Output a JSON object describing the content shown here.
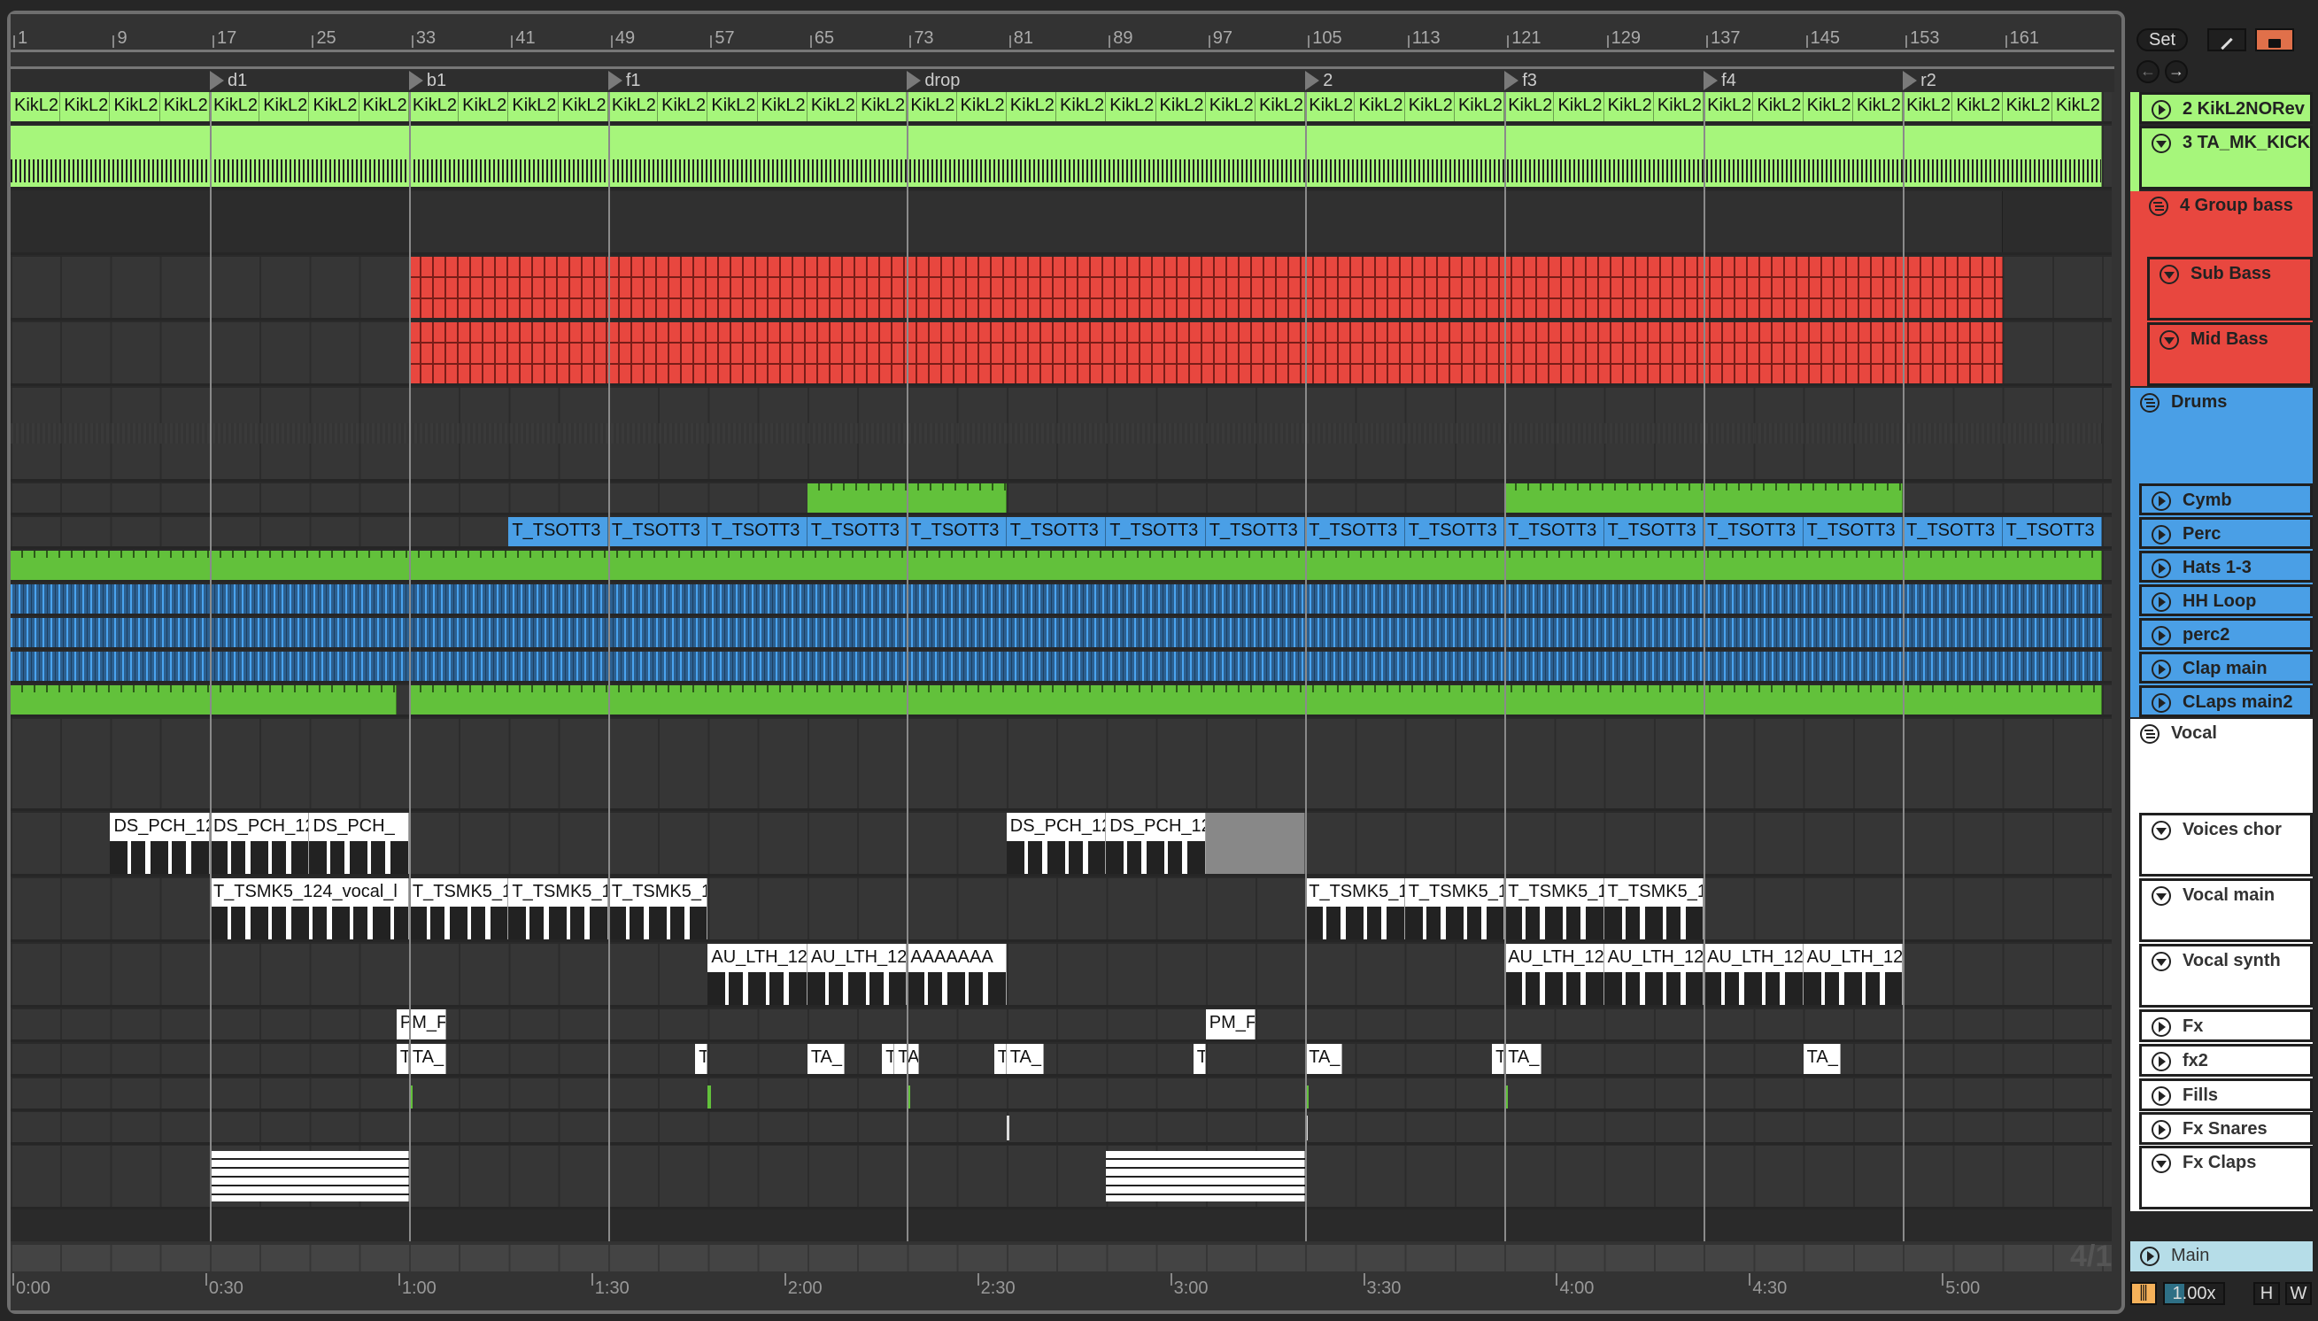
{
  "ruler": {
    "bars": [
      "1",
      "9",
      "17",
      "25",
      "33",
      "41",
      "49",
      "57",
      "65",
      "73",
      "81",
      "89",
      "97",
      "105",
      "113",
      "121",
      "129",
      "137",
      "145",
      "153",
      "161"
    ]
  },
  "locators": [
    {
      "name": "d1",
      "bar": 17
    },
    {
      "name": "b1",
      "bar": 33
    },
    {
      "name": "f1",
      "bar": 49
    },
    {
      "name": "drop",
      "bar": 73
    },
    {
      "name": "2",
      "bar": 105
    },
    {
      "name": "f3",
      "bar": 121
    },
    {
      "name": "f4",
      "bar": 137
    },
    {
      "name": "r2",
      "bar": 153
    }
  ],
  "time_ruler": [
    "0:00",
    "0:30",
    "1:00",
    "1:30",
    "2:00",
    "2:30",
    "3:00",
    "3:30",
    "4:00",
    "4:30",
    "5:00"
  ],
  "tempo_bpm_implied": 124,
  "colors": {
    "kick": "#a6f67b",
    "bass": "#e8473f",
    "drums": "#4a9fe6",
    "green": "#62c13b",
    "vocal": "#ffffff",
    "main": "#b6dde8",
    "lock": "#e0704a",
    "follow": "#f5b15a"
  },
  "tracks": [
    {
      "name": "2 KikL2NORev",
      "icon": "play",
      "color": "#a6f67b"
    },
    {
      "name": "3 TA_MK_KICK",
      "icon": "fold-down",
      "color": "#a6f67b"
    },
    {
      "name": "4 Group bass",
      "icon": "group",
      "color": "#e8473f"
    },
    {
      "name": "Sub Bass",
      "icon": "fold-down",
      "color": "#e8473f"
    },
    {
      "name": "Mid Bass",
      "icon": "fold-down",
      "color": "#e8473f"
    },
    {
      "name": "Drums",
      "icon": "group",
      "color": "#4a9fe6"
    },
    {
      "name": "Cymb",
      "icon": "play",
      "color": "#4a9fe6"
    },
    {
      "name": "Perc",
      "icon": "play",
      "color": "#4a9fe6"
    },
    {
      "name": "Hats 1-3",
      "icon": "play",
      "color": "#4a9fe6"
    },
    {
      "name": "HH Loop",
      "icon": "play",
      "color": "#4a9fe6"
    },
    {
      "name": "perc2",
      "icon": "play",
      "color": "#4a9fe6"
    },
    {
      "name": "Clap main",
      "icon": "play",
      "color": "#4a9fe6"
    },
    {
      "name": "CLaps main2",
      "icon": "play",
      "color": "#4a9fe6"
    },
    {
      "name": "Vocal",
      "icon": "group",
      "color": "#ffffff"
    },
    {
      "name": "Voices chor",
      "icon": "fold-down",
      "color": "#ffffff"
    },
    {
      "name": "Vocal main",
      "icon": "fold-down",
      "color": "#ffffff"
    },
    {
      "name": "Vocal synth",
      "icon": "fold-down",
      "color": "#ffffff"
    },
    {
      "name": "Fx",
      "icon": "play",
      "color": "#ffffff"
    },
    {
      "name": "fx2",
      "icon": "play",
      "color": "#ffffff"
    },
    {
      "name": "Fills",
      "icon": "play",
      "color": "#ffffff"
    },
    {
      "name": "Fx Snares",
      "icon": "play",
      "color": "#ffffff"
    },
    {
      "name": "Fx Claps",
      "icon": "fold-down",
      "color": "#ffffff"
    }
  ],
  "main_track": {
    "name": "Main",
    "icon": "play"
  },
  "clips": {
    "kik_name": "KikL2",
    "perc_name": "T_TSOTT3",
    "voices": [
      {
        "name": "DS_PCH_12",
        "s": 9,
        "e": 17
      },
      {
        "name": "DS_PCH_12",
        "s": 17,
        "e": 25
      },
      {
        "name": "DS_PCH_",
        "s": 25,
        "e": 33
      },
      {
        "name": "DS_PCH_12",
        "s": 81,
        "e": 89
      },
      {
        "name": "DS_PCH_12",
        "s": 89,
        "e": 97
      }
    ],
    "vocal_main": [
      {
        "name": "T_TSMK5_124_vocal_l",
        "s": 17,
        "e": 33
      },
      {
        "name": "T_TSMK5_1",
        "s": 33,
        "e": 41
      },
      {
        "name": "T_TSMK5_1",
        "s": 41,
        "e": 49
      },
      {
        "name": "T_TSMK5_1",
        "s": 49,
        "e": 57
      },
      {
        "name": "T_TSMK5_1",
        "s": 105,
        "e": 113
      },
      {
        "name": "T_TSMK5_1",
        "s": 113,
        "e": 121
      },
      {
        "name": "T_TSMK5_1",
        "s": 121,
        "e": 129
      },
      {
        "name": "T_TSMK5_1",
        "s": 129,
        "e": 137
      }
    ],
    "vocal_synth": [
      {
        "name": "AU_LTH_12",
        "s": 57,
        "e": 65
      },
      {
        "name": "AU_LTH_12",
        "s": 65,
        "e": 73
      },
      {
        "name": "AAAAAAA",
        "s": 73,
        "e": 81
      },
      {
        "name": "AU_LTH_12",
        "s": 121,
        "e": 129
      },
      {
        "name": "AU_LTH_12",
        "s": 129,
        "e": 137
      },
      {
        "name": "AU_LTH_12",
        "s": 137,
        "e": 145
      },
      {
        "name": "AU_LTH_12",
        "s": 145,
        "e": 153
      }
    ],
    "fx": [
      {
        "name": "PM_F",
        "s": 32,
        "e": 36
      },
      {
        "name": "PM_F",
        "s": 97,
        "e": 101
      }
    ],
    "fx2": [
      {
        "name": "T",
        "s": 32,
        "e": 33
      },
      {
        "name": "TA_",
        "s": 33,
        "e": 36
      },
      {
        "name": "T",
        "s": 56,
        "e": 57
      },
      {
        "name": "TA_",
        "s": 65,
        "e": 68
      },
      {
        "name": "T",
        "s": 71,
        "e": 72
      },
      {
        "name": "TA",
        "s": 72,
        "e": 74
      },
      {
        "name": "T",
        "s": 80,
        "e": 81
      },
      {
        "name": "TA_",
        "s": 81,
        "e": 84
      },
      {
        "name": "T",
        "s": 96,
        "e": 97
      },
      {
        "name": "TA_",
        "s": 105,
        "e": 108
      },
      {
        "name": "T",
        "s": 120,
        "e": 121
      },
      {
        "name": "TA_",
        "s": 121,
        "e": 124
      },
      {
        "name": "TA_",
        "s": 145,
        "e": 148
      }
    ],
    "fx_claps": [
      {
        "s": 17,
        "e": 33
      },
      {
        "s": 89,
        "e": 105
      }
    ]
  },
  "controls": {
    "set": "Set",
    "zoom": "1.00x",
    "h": "H",
    "w": "W",
    "grid": "4/1"
  }
}
